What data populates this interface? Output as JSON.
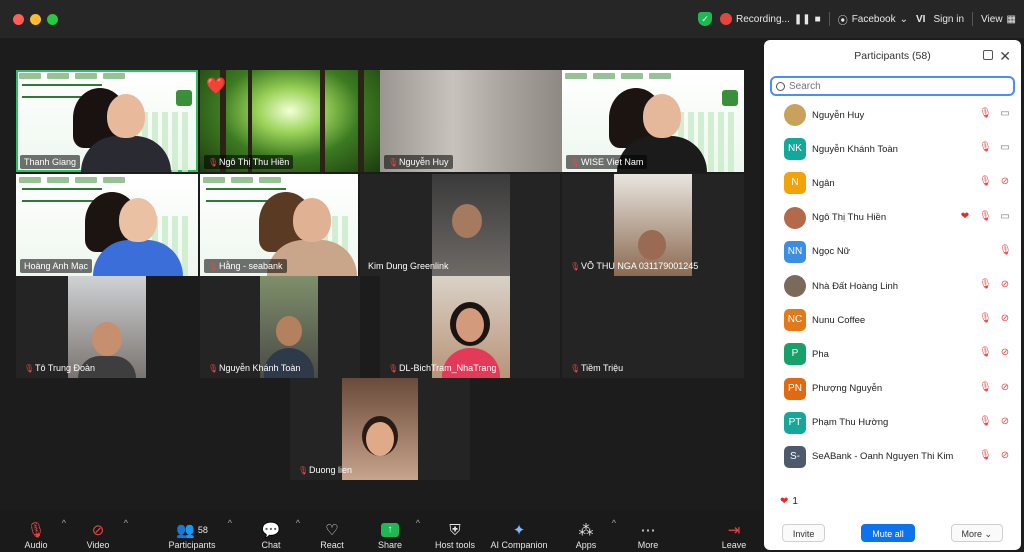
{
  "titlebar": {
    "recording_label": "Recording...",
    "facebook_label": "Facebook",
    "language": "VI",
    "sign_in": "Sign in",
    "view": "View"
  },
  "tiles": [
    {
      "name": "Thanh Giang",
      "kind": "slide",
      "muted": false,
      "active": true
    },
    {
      "name": "Ngô Thị Thu Hiền",
      "kind": "forest",
      "muted": true,
      "reaction": "❤️"
    },
    {
      "name": "Nguyễn Huy",
      "kind": "blur",
      "muted": true
    },
    {
      "name": "WISE Viet Nam",
      "kind": "slide",
      "muted": true
    },
    {
      "name": "Hoàng Anh Mạc",
      "kind": "slide",
      "muted": false
    },
    {
      "name": "Hằng - seabank",
      "kind": "slide",
      "muted": true
    },
    {
      "name": "Kim Dung Greenlink",
      "kind": "dark",
      "muted": false
    },
    {
      "name": "VÕ THU NGA 031179001245",
      "kind": "dark",
      "muted": true
    },
    {
      "name": "Tô Trung Đoàn",
      "kind": "dark",
      "muted": true
    },
    {
      "name": "Nguyễn Khánh Toàn",
      "kind": "dark",
      "muted": true
    },
    {
      "name": "DL-BichTram_NhaTrang",
      "kind": "dark",
      "muted": true
    },
    {
      "name": "Tiềm Triệu",
      "kind": "dark",
      "muted": true
    },
    {
      "name": "Duong lien",
      "kind": "dark",
      "muted": true
    }
  ],
  "toolbar": {
    "audio": "Audio",
    "video": "Video",
    "participants": "Participants",
    "participants_count": "58",
    "chat": "Chat",
    "react": "React",
    "share": "Share",
    "host_tools": "Host tools",
    "ai_companion": "AI Companion",
    "apps": "Apps",
    "more": "More",
    "leave": "Leave"
  },
  "panel": {
    "title": "Participants (58)",
    "search_placeholder": "Search",
    "participants": [
      {
        "name": "Nguyễn Huy",
        "initials": "",
        "color": "#c8a25c",
        "heart": false,
        "video": true
      },
      {
        "name": "Nguyễn Khánh Toàn",
        "initials": "NK",
        "color": "#12a89a",
        "heart": false,
        "video": true
      },
      {
        "name": "Ngân",
        "initials": "N",
        "color": "#f2a20a",
        "heart": false,
        "video": false
      },
      {
        "name": "Ngô Thị Thu Hiền",
        "initials": "",
        "color": "#b36a4a",
        "heart": true,
        "video": true
      },
      {
        "name": "Ngọc Nữ",
        "initials": "NN",
        "color": "#3b8ee0",
        "heart": false,
        "video": null
      },
      {
        "name": "Nhà Đất Hoàng Linh",
        "initials": "",
        "color": "#7a6a5a",
        "heart": false,
        "video": false
      },
      {
        "name": "Nunu Coffee",
        "initials": "NC",
        "color": "#e07a1a",
        "heart": false,
        "video": false
      },
      {
        "name": "Pha",
        "initials": "P",
        "color": "#18a06a",
        "heart": false,
        "video": false
      },
      {
        "name": "Phượng Nguyễn",
        "initials": "PN",
        "color": "#e06a12",
        "heart": false,
        "video": false
      },
      {
        "name": "Phạm Thu Hường",
        "initials": "PT",
        "color": "#15a89a",
        "heart": false,
        "video": false
      },
      {
        "name": "SeABank - Oanh Nguyen Thi Kim",
        "initials": "S-",
        "color": "#4c5a6c",
        "heart": false,
        "video": false
      }
    ],
    "reaction_count": "1",
    "invite": "Invite",
    "mute_all": "Mute all",
    "more": "More"
  },
  "colors": {
    "accent": "#0e72ed",
    "active_speaker": "#22c55e",
    "muted": "#e84545"
  }
}
